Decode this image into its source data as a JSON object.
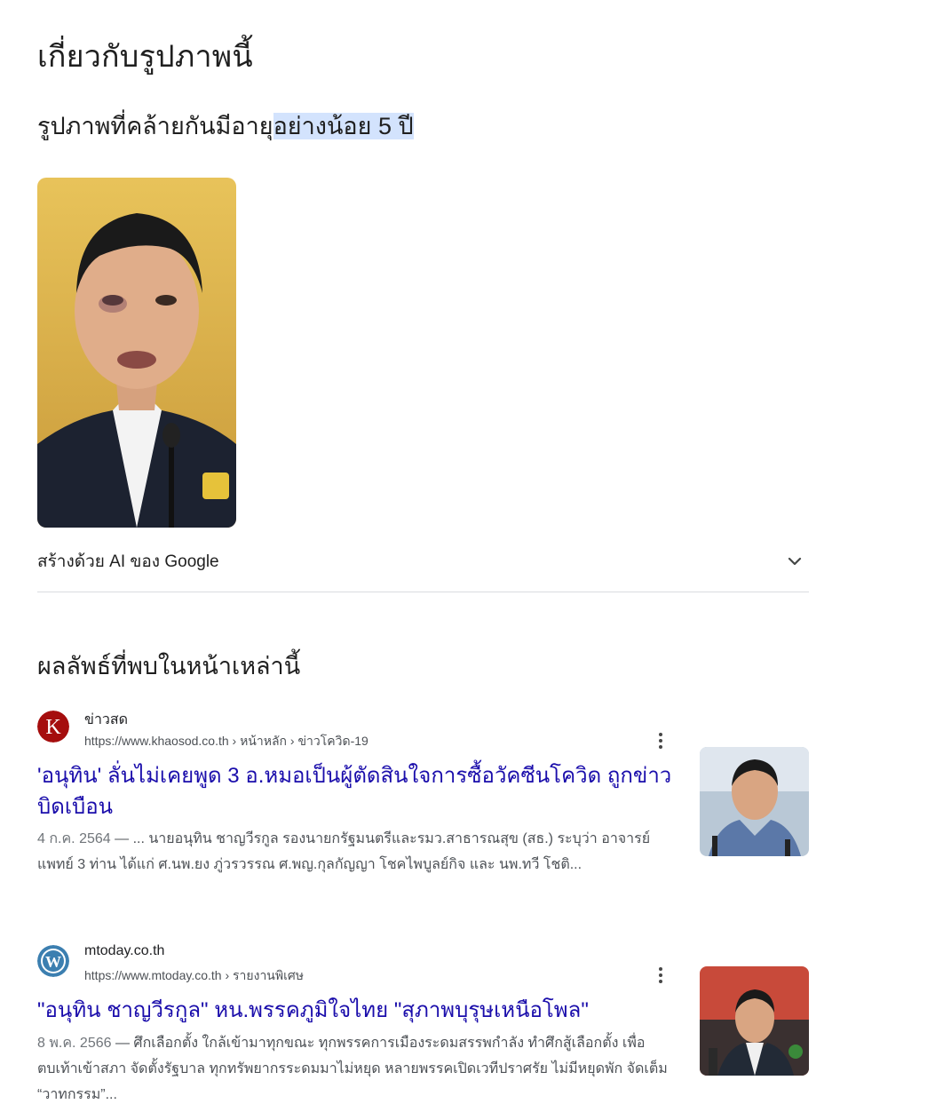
{
  "about": {
    "title": "เกี่ยวกับรูปภาพนี้",
    "subtitle_part1": "รูปภาพที่คล้ายกันมีอาย",
    "subtitle_highlight": "ุอย่างน้อย 5 ปี"
  },
  "ai_section": {
    "label": "สร้างด้วย AI ของ Google",
    "icon": "chevron-down-icon"
  },
  "results_heading": "ผลลัพธ์ที่พบในหน้าเหล่านี้",
  "results": [
    {
      "site_name": "ข่าวสด",
      "favicon_letter": "K",
      "favicon_color": "#a50e0e",
      "url": "https://www.khaosod.co.th › หน้าหลัก › ข่าวโควิด-19",
      "title": "'อนุทิน' ลั่นไม่เคยพูด 3 อ.หมอเป็นผู้ตัดสินใจการซื้อวัคซีนโควิด ถูกข่าวบิดเบือน",
      "date": "4 ก.ค. 2564",
      "snippet": " — ... นายอนุทิน ชาญวีรกูล รองนายกรัฐมนตรีและรมว.สาธารณสุข (สธ.) ระบุว่า อาจารย์แพทย์ 3 ท่าน ได้แก่ ศ.นพ.ยง ภู่วรวรรณ ศ.พญ.กุลกัญญา โชคไพบูลย์กิจ และ นพ.ทวี โชติ..."
    },
    {
      "site_name": "mtoday.co.th",
      "favicon_letter": "W",
      "favicon_color": "#3c7fb0",
      "url": "https://www.mtoday.co.th › รายงานพิเศษ",
      "title": "\"อนุทิน ชาญวีรกูล\" หน.พรรคภูมิใจไทย \"สุภาพบุรุษเหนือโพล\"",
      "date": "8 พ.ค. 2566",
      "snippet": " — ศึกเลือกตั้ง ใกล้เข้ามาทุกขณะ ทุกพรรคการเมืองระดมสรรพกำลัง ทำศึกสู้เลือกตั้ง เพื่อตบเท้าเข้าสภา จัดตั้งรัฐบาล ทุกทรัพยากรระดมมาไม่หยุด หลายพรรคเปิดเวทีปราศรัย ไม่มีหยุดพัก จัดเต็ม “วาทกรรม”..."
    }
  ],
  "colors": {
    "link": "#1a0dab",
    "highlight": "#d3e3fd",
    "divider": "#dadce0"
  }
}
